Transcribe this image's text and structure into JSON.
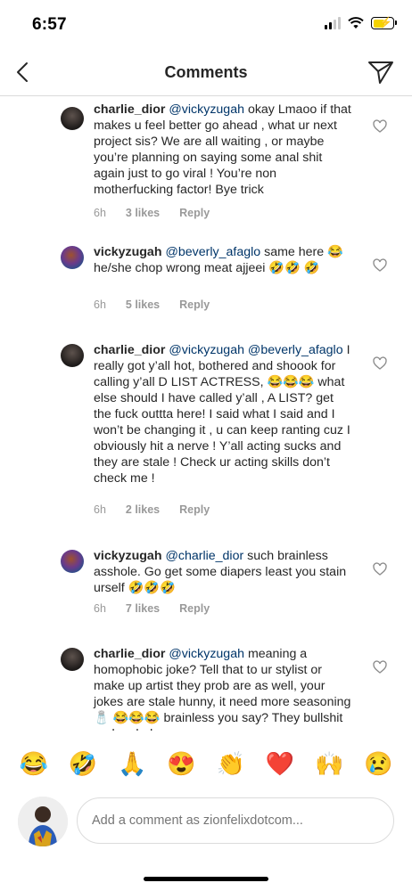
{
  "status": {
    "time": "6:57"
  },
  "header": {
    "title": "Comments"
  },
  "comments": [
    {
      "username": "charlie_dior",
      "mention": "@vickyzugah",
      "text": "okay Lmaoo if that makes u feel better go ahead , what ur next project sis? We are all waiting , or maybe you’re planning on saying some anal shit again just to go viral ! You’re non motherfucking factor! Bye trick",
      "time": "6h",
      "likes": "3 likes",
      "reply": "Reply"
    },
    {
      "username": "vickyzugah",
      "mention": "@beverly_afaglo",
      "text": "same here 😂 he/she chop wrong meat ajjeei 🤣🤣 🤣",
      "time": "6h",
      "likes": "5 likes",
      "reply": "Reply"
    },
    {
      "username": "charlie_dior",
      "mention": "@vickyzugah @beverly_afaglo",
      "text": "I really got y’all hot, bothered and shoook for calling y’all D LIST ACTRESS, 😂😂😂 what else should I have called y’all , A LIST? get the fuck outtta here! I said what I said and I won’t be changing it , u can keep ranting cuz I obviously hit a nerve ! Y’all acting sucks and they are stale ! Check ur acting skills don’t check me !",
      "time": "6h",
      "likes": "2 likes",
      "reply": "Reply"
    },
    {
      "username": "vickyzugah",
      "mention": "@charlie_dior",
      "text": "such brainless asshole. Go get some diapers least you stain urself 🤣🤣🤣",
      "time": "6h",
      "likes": "7 likes",
      "reply": "Reply"
    },
    {
      "username": "charlie_dior",
      "mention": "@vickyzugah",
      "text": "meaning a homophobic joke? Tell that to ur stylist or make up artist they prob are as well, your jokes are stale hunny, it need more seasoning 🧂 😂😂😂 brainless you say? They bullshit and malarkey u spew",
      "time": "",
      "likes": "",
      "reply": ""
    }
  ],
  "emoji_bar": [
    "😂",
    "🤣",
    "🙏",
    "😍",
    "👏",
    "❤️",
    "🙌",
    "😢"
  ],
  "compose": {
    "placeholder": "Add a comment as zionfelixdotcom..."
  },
  "icons": {
    "back": "chevron-left-icon",
    "share": "paper-plane-icon",
    "like": "heart-outline-icon"
  }
}
